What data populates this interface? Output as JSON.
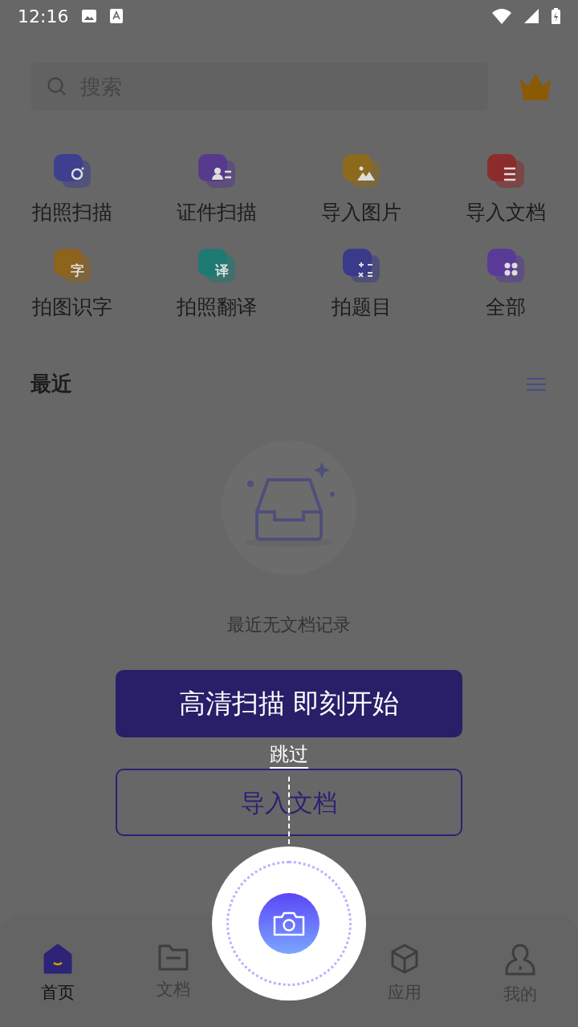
{
  "status_bar": {
    "time": "12:16"
  },
  "search": {
    "placeholder": "搜索"
  },
  "tools": [
    {
      "label": "拍照扫描",
      "color": "#3e3f8e"
    },
    {
      "label": "证件扫描",
      "color": "#573a8c"
    },
    {
      "label": "导入图片",
      "color": "#8c6a1e"
    },
    {
      "label": "导入文档",
      "color": "#8c2c2c"
    },
    {
      "label": "拍图识字",
      "color": "#8c641e",
      "icon_text": "字"
    },
    {
      "label": "拍照翻译",
      "color": "#1e7a72",
      "icon_text": "译"
    },
    {
      "label": "拍题目",
      "color": "#3a3a8a"
    },
    {
      "label": "全部",
      "color": "#5a3a98"
    }
  ],
  "recent": {
    "title": "最近",
    "empty_text": "最近无文档记录"
  },
  "guide": {
    "banner": "高清扫描 即刻开始",
    "skip": "跳过",
    "button": "导入文档"
  },
  "tabs": [
    {
      "label": "首页",
      "selected": true
    },
    {
      "label": "文档",
      "selected": false
    },
    {
      "label": "应用",
      "selected": false
    },
    {
      "label": "我的",
      "selected": false
    }
  ]
}
